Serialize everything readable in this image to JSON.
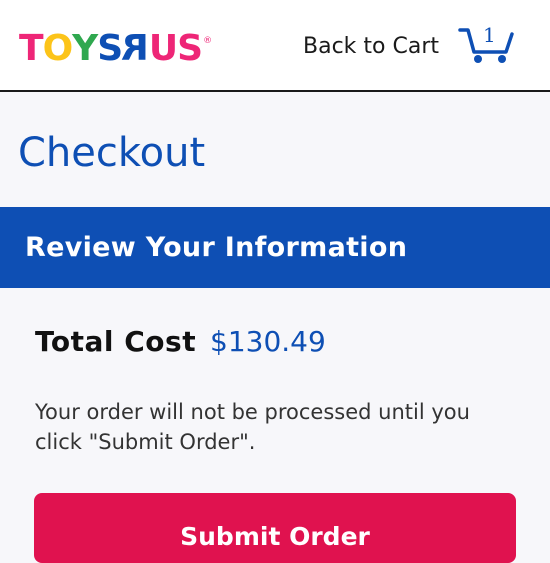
{
  "header": {
    "logo": {
      "text": "TOYSRUS",
      "registered_mark": "®",
      "letters": [
        {
          "char": "T",
          "color": "#ee2677"
        },
        {
          "char": "O",
          "color": "#fcc419"
        },
        {
          "char": "Y",
          "color": "#2fa84f"
        },
        {
          "char": "S",
          "color": "#0e4fb4"
        },
        {
          "char": "R",
          "color": "#0e4fb4"
        },
        {
          "char": "U",
          "color": "#ee2677"
        },
        {
          "char": "S",
          "color": "#ee2677"
        }
      ]
    },
    "back_link": "Back to Cart",
    "cart": {
      "icon": "cart-icon",
      "count": "1"
    }
  },
  "page_title": "Checkout",
  "section": {
    "title": "Review Your Information"
  },
  "summary": {
    "total_label": "Total Cost",
    "total_value": "$130.49",
    "notice": "Your order will not be processed until you click \"Submit Order\"."
  },
  "actions": {
    "submit_label": "Submit Order"
  },
  "colors": {
    "brand_blue": "#0e4fb4",
    "brand_pink": "#e0124f",
    "background": "#f7f7fa"
  }
}
